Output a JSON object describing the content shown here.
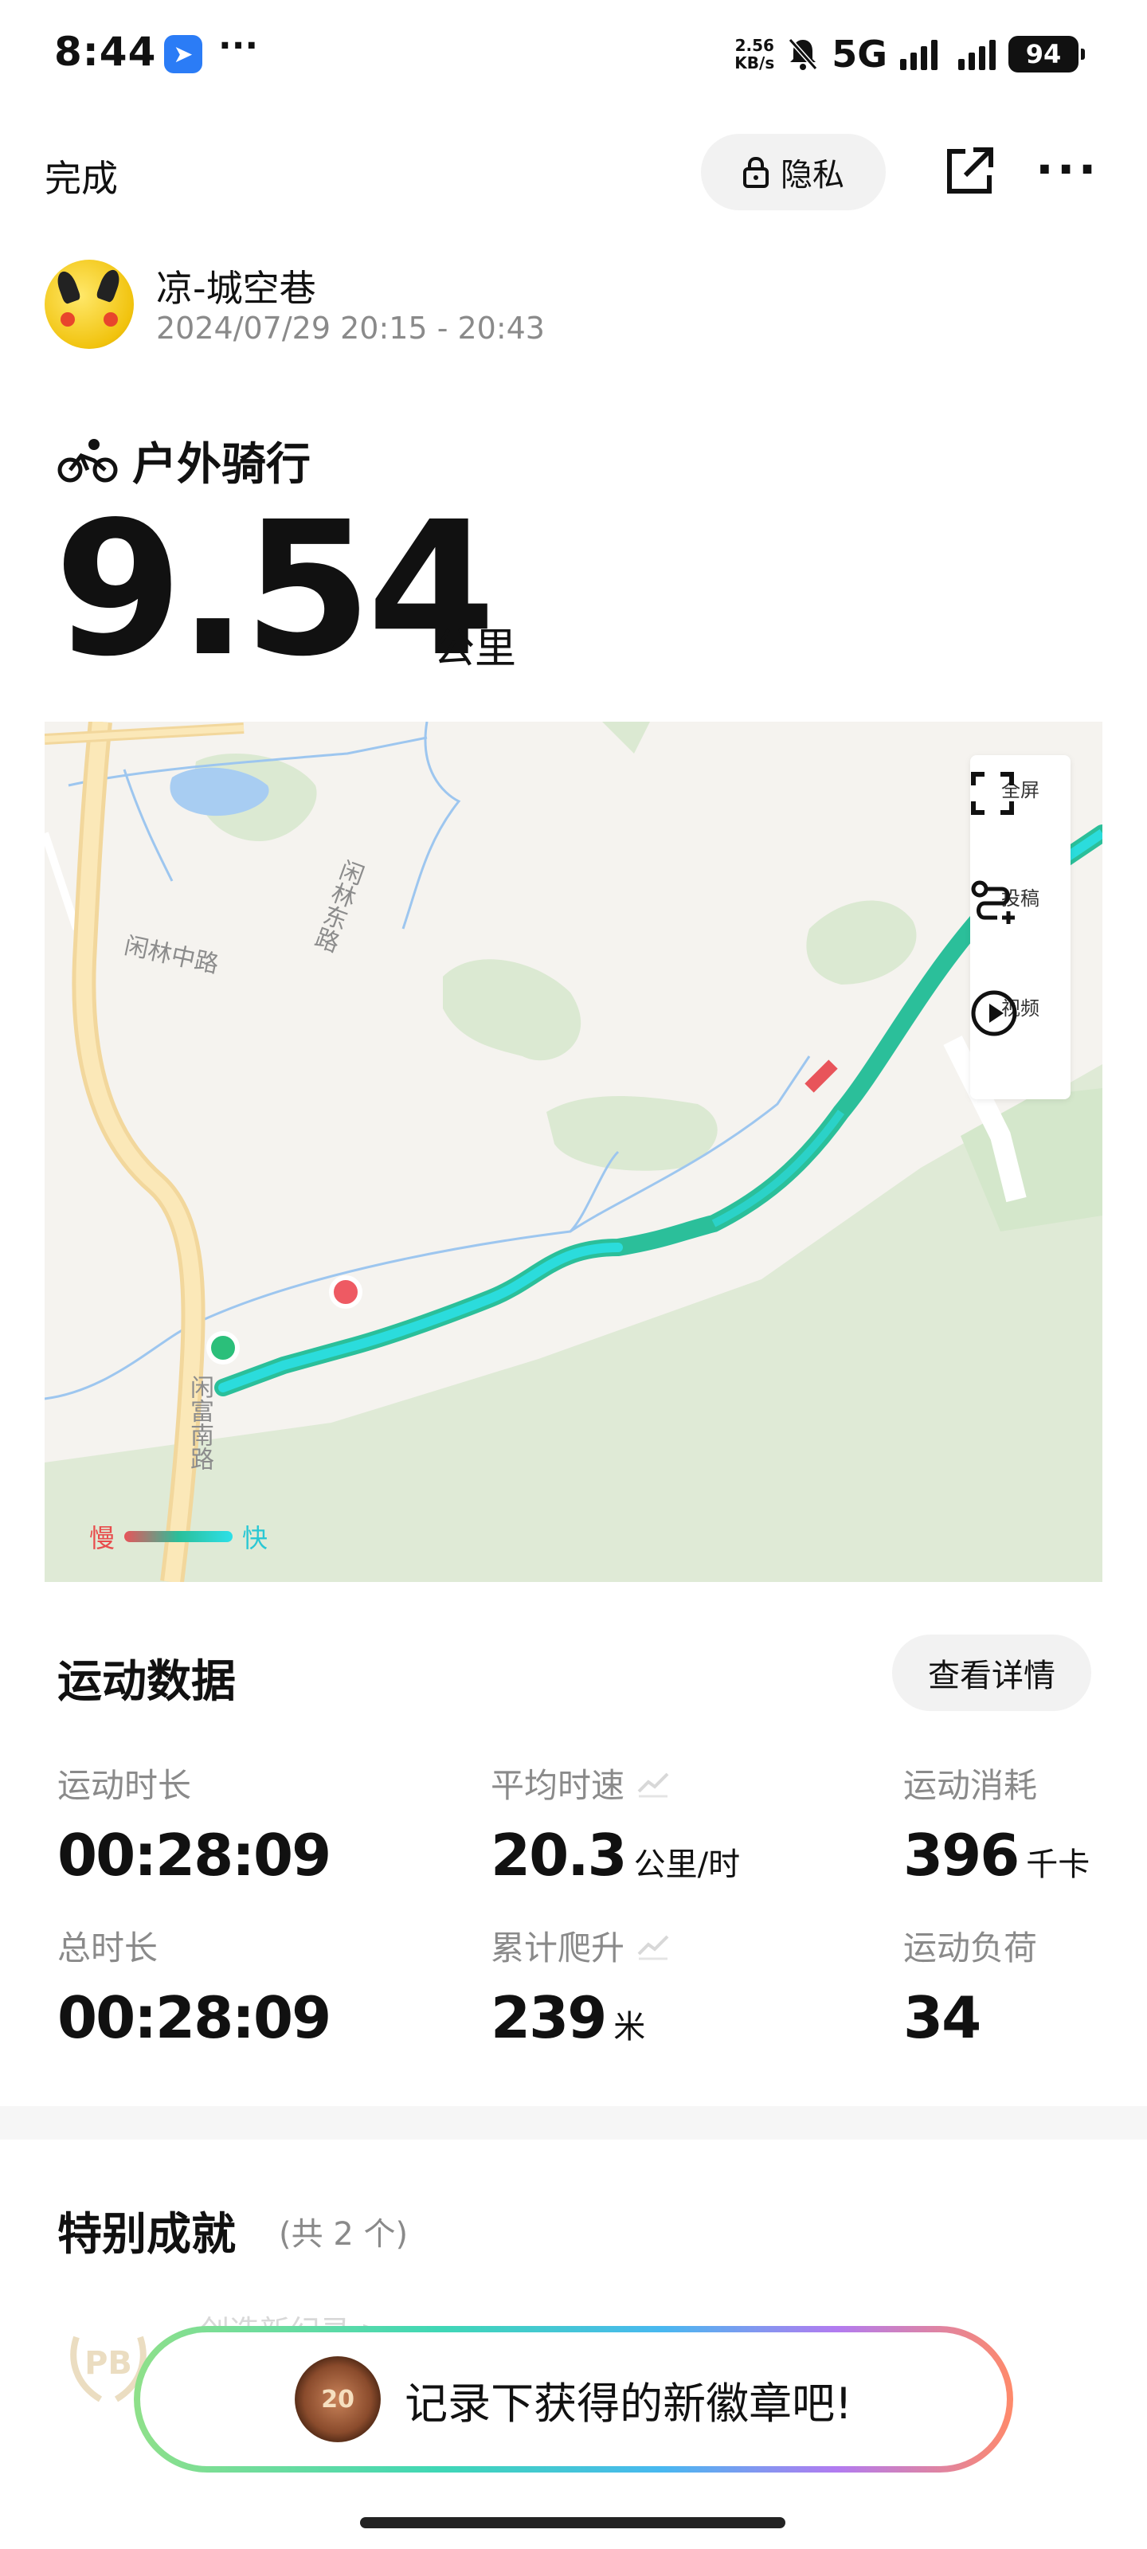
{
  "status_bar": {
    "time": "8:44",
    "dots": "···",
    "net_speed_value": "2.56",
    "net_speed_unit": "KB/s",
    "network": "5G",
    "battery": "94"
  },
  "top_bar": {
    "done_label": "完成",
    "privacy_label": "隐私",
    "more_label": "···"
  },
  "user": {
    "name": "凉-城空巷",
    "time_range": "2024/07/29 20:15 - 20:43"
  },
  "activity": {
    "type": "户外骑行",
    "distance": "9.54",
    "distance_unit": "公里"
  },
  "map": {
    "road_labels": [
      "闲林东路",
      "闲林中路",
      "闲富南路"
    ],
    "tools": [
      {
        "label": "全屏",
        "icon": "fullscreen-icon"
      },
      {
        "label": "投稿",
        "icon": "route-submit-icon"
      },
      {
        "label": "视频",
        "icon": "play-video-icon"
      }
    ],
    "legend": {
      "slow": "慢",
      "fast": "快"
    },
    "colors": {
      "route_fast": "#2ce0e8",
      "route_mid": "#2bbf9a",
      "route_slow": "#e8545a",
      "start_point": "#2bbf7a",
      "marker": "#ee5a63"
    }
  },
  "stats": {
    "title": "运动数据",
    "details_label": "查看详情",
    "items": [
      {
        "label": "运动时长",
        "value": "00:28:09",
        "unit": ""
      },
      {
        "label": "平均时速",
        "value": "20.3",
        "unit": "公里/时"
      },
      {
        "label": "运动消耗",
        "value": "396",
        "unit": "千卡"
      },
      {
        "label": "总时长",
        "value": "00:28:09",
        "unit": ""
      },
      {
        "label": "累计爬升",
        "value": "239",
        "unit": "米"
      },
      {
        "label": "运动负荷",
        "value": "34",
        "unit": ""
      }
    ]
  },
  "achievements": {
    "title": "特别成就",
    "count": "(共 2 个)",
    "first_item": "创造新纪录 >",
    "badge_text": "PB"
  },
  "banner": {
    "text": "记录下获得的新徽章吧!",
    "medal_number": "20"
  }
}
